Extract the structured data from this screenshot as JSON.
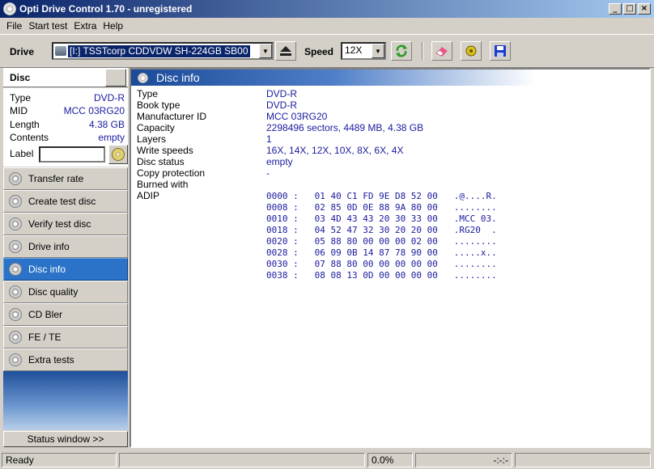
{
  "window": {
    "title": "Opti Drive Control 1.70 - unregistered",
    "min": "_",
    "max": "□",
    "close": "×"
  },
  "menu": [
    "File",
    "Start test",
    "Extra",
    "Help"
  ],
  "toolbar": {
    "drive_label": "Drive",
    "drive_value": "[I:]  TSSTcorp CDDVDW SH-224GB SB00",
    "speed_label": "Speed",
    "speed_value": "12X"
  },
  "disc_panel": {
    "title": "Disc",
    "props": [
      {
        "key": "Type",
        "value": "DVD-R"
      },
      {
        "key": "MID",
        "value": "MCC 03RG20"
      },
      {
        "key": "Length",
        "value": "4.38 GB"
      },
      {
        "key": "Contents",
        "value": "empty"
      }
    ],
    "label_key": "Label",
    "label_value": ""
  },
  "nav": [
    {
      "label": "Transfer rate",
      "active": false
    },
    {
      "label": "Create test disc",
      "active": false
    },
    {
      "label": "Verify test disc",
      "active": false
    },
    {
      "label": "Drive info",
      "active": false
    },
    {
      "label": "Disc info",
      "active": true
    },
    {
      "label": "Disc quality",
      "active": false
    },
    {
      "label": "CD Bler",
      "active": false
    },
    {
      "label": "FE / TE",
      "active": false
    },
    {
      "label": "Extra tests",
      "active": false
    }
  ],
  "status_window_button": "Status window >>",
  "main": {
    "title": "Disc info",
    "rows": [
      {
        "key": "Type",
        "value": "DVD-R"
      },
      {
        "key": "Book type",
        "value": "DVD-R"
      },
      {
        "key": "Manufacturer ID",
        "value": "MCC 03RG20"
      },
      {
        "key": "Capacity",
        "value": "2298496 sectors, 4489 MB, 4.38 GB"
      },
      {
        "key": "Layers",
        "value": "1"
      },
      {
        "key": "Write speeds",
        "value": "16X, 14X, 12X, 10X, 8X, 6X, 4X"
      },
      {
        "key": "Disc status",
        "value": "empty"
      },
      {
        "key": "Copy protection",
        "value": "-"
      },
      {
        "key": "Burned with",
        "value": ""
      },
      {
        "key": "ADIP",
        "value": ""
      }
    ],
    "adip": [
      "0000 :   01 40 C1 FD 9E D8 52 00   .@....R.",
      "0008 :   02 85 0D 0E 88 9A 80 00   ........",
      "0010 :   03 4D 43 43 20 30 33 00   .MCC 03.",
      "0018 :   04 52 47 32 30 20 20 00   .RG20  .",
      "0020 :   05 88 80 00 00 00 02 00   ........",
      "0028 :   06 09 0B 14 87 78 90 00   .....x..",
      "0030 :   07 88 80 00 00 00 00 00   ........",
      "0038 :   08 08 13 0D 00 00 00 00   ........"
    ]
  },
  "statusbar": {
    "status": "Ready",
    "progress": "0.0%",
    "time": "-:-:-"
  }
}
